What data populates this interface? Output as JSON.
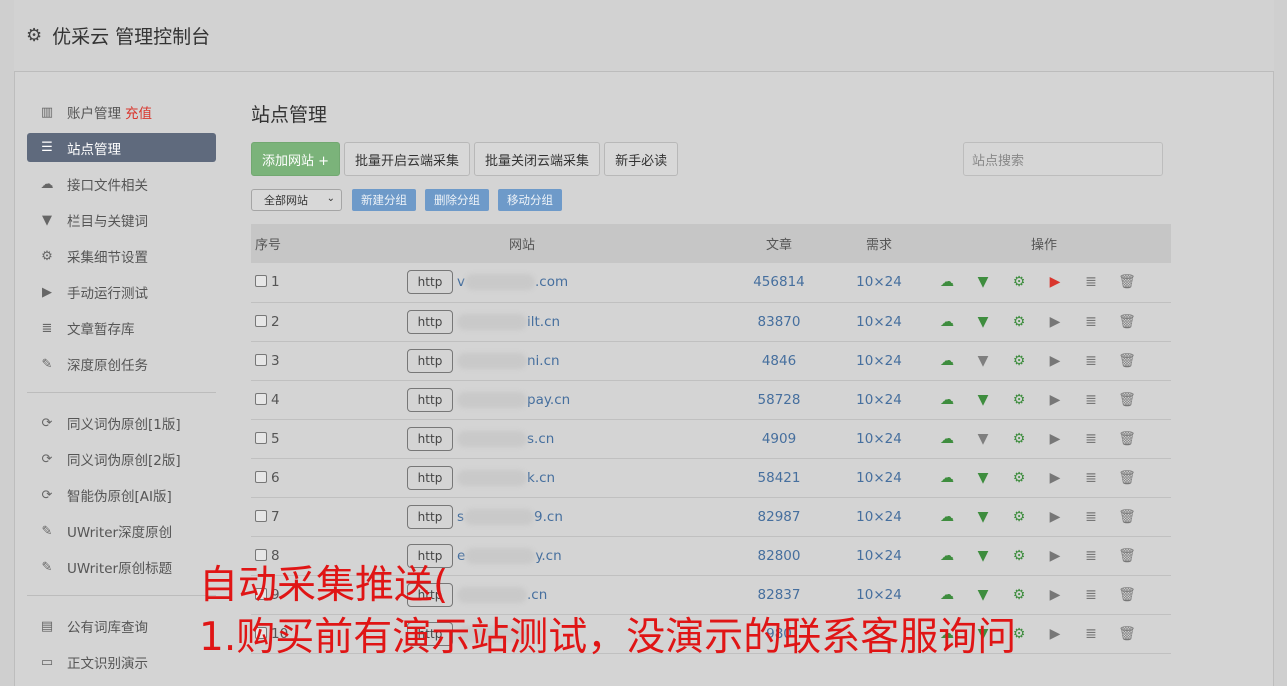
{
  "header": {
    "title": "优采云 管理控制台"
  },
  "sidebar": {
    "group1": [
      {
        "label": "账户管理",
        "extra": "充值",
        "icon": "bar-chart-icon"
      },
      {
        "label": "站点管理",
        "icon": "server-icon",
        "active": true
      },
      {
        "label": "接口文件相关",
        "icon": "cloud-upload-icon"
      },
      {
        "label": "栏目与关键词",
        "icon": "filter-icon"
      },
      {
        "label": "采集细节设置",
        "icon": "cogs-icon"
      },
      {
        "label": "手动运行测试",
        "icon": "play-icon"
      },
      {
        "label": "文章暂存库",
        "icon": "database-icon"
      },
      {
        "label": "深度原创任务",
        "icon": "edit-icon"
      }
    ],
    "group2": [
      {
        "label": "同义词伪原创[1版]",
        "icon": "refresh-icon"
      },
      {
        "label": "同义词伪原创[2版]",
        "icon": "refresh-icon"
      },
      {
        "label": "智能伪原创[AI版]",
        "icon": "refresh-icon"
      },
      {
        "label": "UWriter深度原创",
        "icon": "edit-icon"
      },
      {
        "label": "UWriter原创标题",
        "icon": "edit-icon"
      }
    ],
    "group3": [
      {
        "label": "公有词库查询",
        "icon": "book-icon"
      },
      {
        "label": "正文识别演示",
        "icon": "monitor-icon"
      }
    ]
  },
  "main": {
    "title": "站点管理",
    "buttons": {
      "add": "添加网站 +",
      "batch_open": "批量开启云端采集",
      "batch_close": "批量关闭云端采集",
      "guide": "新手必读"
    },
    "search_placeholder": "站点搜索",
    "group_select": "全部网站",
    "group_buttons": {
      "new": "新建分组",
      "delete": "删除分组",
      "move": "移动分组"
    },
    "table": {
      "headers": {
        "no": "序号",
        "site": "网站",
        "articles": "文章",
        "demand": "需求",
        "ops": "操作"
      },
      "http_label": "http",
      "rows": [
        {
          "no": "1",
          "prefix": "v",
          "domain": ".com",
          "articles": "456814",
          "demand": "10×24",
          "filter_on": true,
          "play_on": true
        },
        {
          "no": "2",
          "prefix": "",
          "domain": "ilt.cn",
          "articles": "83870",
          "demand": "10×24",
          "filter_on": true,
          "play_on": false
        },
        {
          "no": "3",
          "prefix": "",
          "domain": "ni.cn",
          "articles": "4846",
          "demand": "10×24",
          "filter_on": false,
          "play_on": false
        },
        {
          "no": "4",
          "prefix": "",
          "domain": "pay.cn",
          "articles": "58728",
          "demand": "10×24",
          "filter_on": true,
          "play_on": false
        },
        {
          "no": "5",
          "prefix": "",
          "domain": "s.cn",
          "articles": "4909",
          "demand": "10×24",
          "filter_on": false,
          "play_on": false
        },
        {
          "no": "6",
          "prefix": "",
          "domain": "k.cn",
          "articles": "58421",
          "demand": "10×24",
          "filter_on": true,
          "play_on": false
        },
        {
          "no": "7",
          "prefix": "s",
          "domain": "9.cn",
          "articles": "82987",
          "demand": "10×24",
          "filter_on": true,
          "play_on": false
        },
        {
          "no": "8",
          "prefix": "e",
          "domain": "y.cn",
          "articles": "82800",
          "demand": "10×24",
          "filter_on": true,
          "play_on": false
        },
        {
          "no": "9",
          "prefix": "",
          "domain": ".cn",
          "articles": "82837",
          "demand": "10×24",
          "filter_on": true,
          "play_on": false
        },
        {
          "no": "10",
          "prefix": "",
          "domain": "",
          "articles": "980",
          "demand": "",
          "filter_on": true,
          "play_on": false
        }
      ]
    }
  },
  "overlay": {
    "line1": "自动采集推送(",
    "line2": "1.购买前有演示站测试，没演示的联系客服询问"
  },
  "colors": {
    "sidebar_active": "#5f6a7d",
    "green_button": "#7bb37a",
    "blue_button": "#6e9ac9",
    "link": "#466f9e",
    "overlay_red": "#e01515"
  }
}
